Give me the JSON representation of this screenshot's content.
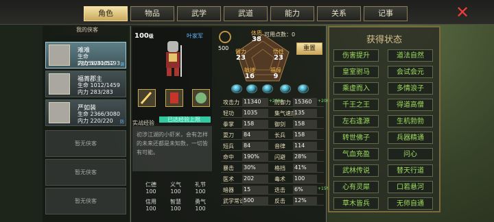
{
  "tabs": [
    "角色",
    "物品",
    "武学",
    "武道",
    "能力",
    "关系",
    "记事"
  ],
  "left": {
    "header": "我的侠客",
    "cards": [
      {
        "name": "难难",
        "hp": "生命 28056/30052",
        "mp": "内力 5081/5193",
        "tag": "调"
      },
      {
        "name": "福菁郡主",
        "hp": "生命 1012/1459",
        "mp": "内力 283/283"
      },
      {
        "name": "严如装",
        "hp": "生命 2366/3080",
        "mp": "内力 220/220",
        "tag": "防"
      }
    ],
    "empty": [
      "暂无侠客",
      "暂无侠客",
      "暂无侠客",
      "暂无侠客"
    ]
  },
  "hero": {
    "level": "100",
    "level_suffix": "级",
    "faction": "叶家军",
    "exp_label": "实战经验",
    "exp_text": "已达经验上限",
    "exp_fill": 1.0,
    "description": "初涉江湖的小虾米，会有怎样的未来还都是未知数，一切皆有可能。"
  },
  "top_stat": {
    "value": "500"
  },
  "points": {
    "label": "可用点数：",
    "value": "0"
  },
  "reset": "重置",
  "pentagon": {
    "体质": "38",
    "臂力": "23",
    "悟性": "23",
    "敏捷": "16",
    "福缘": "9"
  },
  "stats": [
    [
      "攻击力",
      "11340",
      "+2094",
      "防御力",
      "15360",
      "+2068"
    ],
    [
      "轻功",
      "1035",
      "",
      "集气速度",
      "135",
      ""
    ],
    [
      "拳掌",
      "158",
      "",
      "御剑",
      "158",
      ""
    ],
    [
      "耍刀",
      "84",
      "",
      "长兵",
      "158",
      ""
    ],
    [
      "短兵",
      "84",
      "",
      "音律",
      "114",
      ""
    ],
    [
      "命中",
      "190%",
      "",
      "闪避",
      "28%",
      ""
    ],
    [
      "暴击",
      "30%",
      "",
      "格挡",
      "41%",
      ""
    ],
    [
      "医术",
      "202",
      "",
      "毒术",
      "100",
      ""
    ],
    [
      "暗器",
      "15",
      "",
      "迭击",
      "6%",
      "+15%"
    ],
    [
      "武学常识",
      "500",
      "",
      "反击",
      "12%",
      ""
    ]
  ],
  "virtues": [
    {
      "label": "仁德",
      "value": "100"
    },
    {
      "label": "义气",
      "value": "100"
    },
    {
      "label": "礼节",
      "value": "100"
    },
    {
      "label": "信用",
      "value": "100"
    },
    {
      "label": "智慧",
      "value": "100"
    },
    {
      "label": "勇气",
      "value": "100"
    }
  ],
  "right": {
    "title": "获得状态",
    "items": [
      "伤害提升",
      "道法自然",
      "皇室驸马",
      "会试会元",
      "乘虚而入",
      "多情浪子",
      "千王之王",
      "得道高僧",
      "左右逢源",
      "生机勃勃",
      "转世佛子",
      "兵器精通",
      "气血充盈",
      "问心",
      "武林传说",
      "替天行道",
      "心有灵犀",
      "口若悬河",
      "草木皆兵",
      "无师自通"
    ]
  }
}
